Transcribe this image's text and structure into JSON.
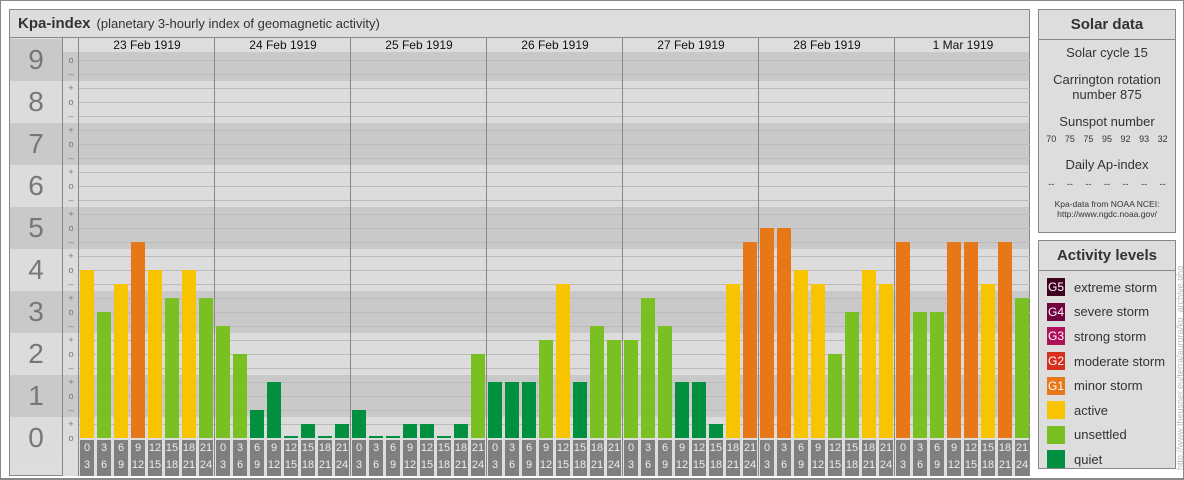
{
  "title": {
    "main": "Kpa-index",
    "sub": "(planetary 3-hourly index of geomagnetic activity)"
  },
  "chart_data": {
    "type": "bar",
    "title": "Kpa-index",
    "subtitle": "(planetary 3-hourly index of geomagnetic activity)",
    "ylim": [
      0,
      9
    ],
    "y_ticks": [
      "0",
      "1",
      "2",
      "3",
      "4",
      "5",
      "6",
      "7",
      "8",
      "9"
    ],
    "third_marks": [
      "o",
      "+",
      "–"
    ],
    "days": [
      "23 Feb 1919",
      "24 Feb 1919",
      "25 Feb 1919",
      "26 Feb 1919",
      "27 Feb 1919",
      "28 Feb 1919",
      "1 Mar 1919"
    ],
    "hour_intervals": [
      [
        "0",
        "3"
      ],
      [
        "3",
        "6"
      ],
      [
        "6",
        "9"
      ],
      [
        "9",
        "12"
      ],
      [
        "12",
        "15"
      ],
      [
        "15",
        "18"
      ],
      [
        "18",
        "21"
      ],
      [
        "21",
        "24"
      ]
    ],
    "series": [
      {
        "name": "23 Feb 1919",
        "values": [
          4.0,
          3.0,
          3.667,
          4.667,
          4.0,
          3.333,
          4.0,
          3.333
        ]
      },
      {
        "name": "24 Feb 1919",
        "values": [
          2.667,
          2.0,
          0.667,
          1.333,
          0.0,
          0.333,
          0.0,
          0.333
        ]
      },
      {
        "name": "25 Feb 1919",
        "values": [
          0.667,
          0.0,
          0.0,
          0.333,
          0.333,
          0.0,
          0.333,
          2.0
        ]
      },
      {
        "name": "26 Feb 1919",
        "values": [
          1.333,
          1.333,
          1.333,
          2.333,
          3.667,
          1.333,
          2.667,
          2.333
        ]
      },
      {
        "name": "27 Feb 1919",
        "values": [
          2.333,
          3.333,
          2.667,
          1.333,
          1.333,
          0.333,
          3.667,
          4.667
        ]
      },
      {
        "name": "28 Feb 1919",
        "values": [
          5.0,
          5.0,
          4.0,
          3.667,
          2.0,
          3.0,
          4.0,
          3.667
        ]
      },
      {
        "name": "1 Mar 1919",
        "values": [
          4.667,
          3.0,
          3.0,
          4.667,
          4.667,
          3.667,
          4.667,
          3.333
        ]
      }
    ],
    "colors": {
      "quiet": "#009040",
      "unsettled": "#7ac022",
      "active": "#f8c400",
      "G1": "#e67818",
      "G2": "#d83020",
      "G3": "#b0105a",
      "G4": "#700040",
      "G5": "#400020"
    },
    "grid": true
  },
  "solar": {
    "header": "Solar data",
    "cycle": "Solar cycle 15",
    "carrington": "Carrington rotation number 875",
    "sunspot_label": "Sunspot number",
    "sunspots": [
      "70",
      "75",
      "75",
      "95",
      "92",
      "93",
      "32"
    ],
    "ap_label": "Daily Ap-index",
    "ap": [
      "--",
      "--",
      "--",
      "--",
      "--",
      "--",
      "--"
    ],
    "source1": "Kpa-data from NOAA NCEI:",
    "source2": "http://www.ngdc.noaa.gov/"
  },
  "activity": {
    "header": "Activity levels",
    "levels": [
      {
        "code": "G5",
        "label": "extreme storm",
        "color": "#400020"
      },
      {
        "code": "G4",
        "label": "severe storm",
        "color": "#700040"
      },
      {
        "code": "G3",
        "label": "strong storm",
        "color": "#b0105a"
      },
      {
        "code": "G2",
        "label": "moderate storm",
        "color": "#d83020"
      },
      {
        "code": "G1",
        "label": "minor storm",
        "color": "#e67818"
      },
      {
        "code": "",
        "label": "active",
        "color": "#f8c400"
      },
      {
        "code": "",
        "label": "unsettled",
        "color": "#7ac022"
      },
      {
        "code": "",
        "label": "quiet",
        "color": "#009040"
      }
    ]
  },
  "watermark": "http://www.theusner.eu/terra/aurora/kp_archive.php"
}
